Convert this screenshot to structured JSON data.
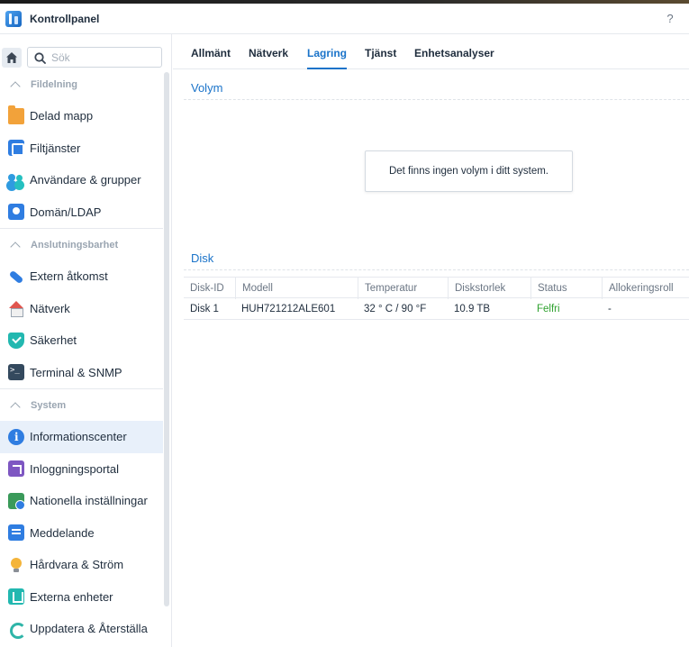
{
  "window": {
    "title": "Kontrollpanel",
    "help": "?"
  },
  "search": {
    "placeholder": "Sök",
    "value": ""
  },
  "sidebar": {
    "groups": [
      {
        "label": "Fildelning",
        "items": [
          {
            "label": "Delad mapp",
            "icon": "shared-folder-icon"
          },
          {
            "label": "Filtjänster",
            "icon": "file-services-icon"
          },
          {
            "label": "Användare & grupper",
            "icon": "users-groups-icon"
          },
          {
            "label": "Domän/LDAP",
            "icon": "domain-ldap-icon"
          }
        ]
      },
      {
        "label": "Anslutningsbarhet",
        "items": [
          {
            "label": "Extern åtkomst",
            "icon": "external-access-icon"
          },
          {
            "label": "Nätverk",
            "icon": "network-icon"
          },
          {
            "label": "Säkerhet",
            "icon": "security-icon"
          },
          {
            "label": "Terminal & SNMP",
            "icon": "terminal-icon"
          }
        ]
      },
      {
        "label": "System",
        "items": [
          {
            "label": "Informationscenter",
            "icon": "info-center-icon",
            "active": true
          },
          {
            "label": "Inloggningsportal",
            "icon": "login-portal-icon"
          },
          {
            "label": "Nationella inställningar",
            "icon": "regional-options-icon"
          },
          {
            "label": "Meddelande",
            "icon": "notification-icon"
          },
          {
            "label": "Hårdvara & Ström",
            "icon": "hardware-power-icon"
          },
          {
            "label": "Externa enheter",
            "icon": "external-devices-icon"
          },
          {
            "label": "Uppdatera & Återställa",
            "icon": "update-restore-icon"
          }
        ]
      }
    ]
  },
  "tabs": [
    {
      "label": "Allmänt"
    },
    {
      "label": "Nätverk"
    },
    {
      "label": "Lagring",
      "active": true
    },
    {
      "label": "Tjänst"
    },
    {
      "label": "Enhetsanalyser"
    }
  ],
  "volume": {
    "title": "Volym",
    "empty_message": "Det finns ingen volym i ditt system."
  },
  "disk": {
    "title": "Disk",
    "columns": [
      "Disk-ID",
      "Modell",
      "Temperatur",
      "Diskstorlek",
      "Status",
      "Allokeringsroll"
    ],
    "rows": [
      {
        "id": "Disk 1",
        "model": "HUH721212ALE601",
        "temperature": "32 ° C / 90 °F",
        "size": "10.9 TB",
        "status": "Felfri",
        "role": "-"
      }
    ]
  },
  "colors": {
    "accent": "#1a73c9",
    "status_ok": "#2ea12e",
    "active_bg": "#e8f0fa"
  }
}
